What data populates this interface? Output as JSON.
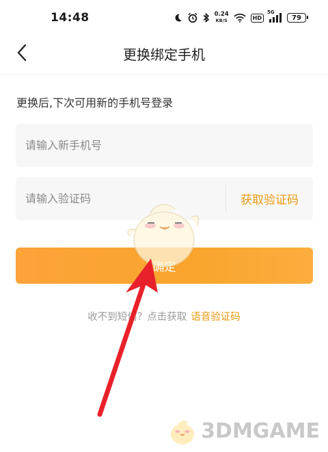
{
  "status_bar": {
    "time": "14:48",
    "net_speed": "0.24",
    "net_unit": "KB/S",
    "hd_label": "HD",
    "signal_label": "5G",
    "battery": "79",
    "icons": [
      "moon-icon",
      "alarm-icon",
      "bluetooth-icon",
      "wifi-icon",
      "signal-icon"
    ]
  },
  "nav": {
    "back_icon": "chevron-left-icon",
    "title": "更换绑定手机"
  },
  "form": {
    "hint": "更换后,下次可用新的手机号登录",
    "phone_placeholder": "请输入新手机号",
    "code_placeholder": "请输入验证码",
    "get_code_label": "获取验证码",
    "confirm_label": "确定"
  },
  "voice": {
    "prefix": "收不到短信？点击获取",
    "link": "语音验证码"
  },
  "overlay": {
    "arrow_color": "#e8212a",
    "watermark_text": "3DMGAME"
  },
  "colors": {
    "accent": "#e89b12",
    "button": "#fba535"
  }
}
